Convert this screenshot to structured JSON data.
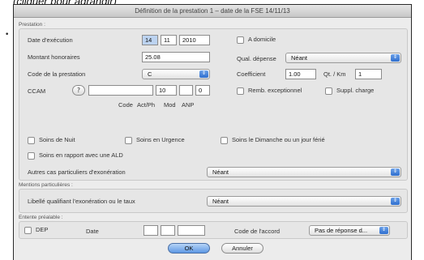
{
  "caption": "(cliquer pour agrandir)",
  "bullet": "•",
  "dialog": {
    "title": "Définition de la prestation 1 – date de la FSE 14/11/13"
  },
  "prestation": {
    "section_label": "Prestation :",
    "date_label": "Date d'exécution",
    "date_day": "14",
    "date_month": "11",
    "date_year": "2010",
    "domicile_label": "A domicile",
    "montant_label": "Montant honoraires",
    "montant_value": "25.08",
    "qual_label": "Qual. dépense",
    "qual_value": "Néant",
    "code_label": "Code de la prestation",
    "code_value": "C",
    "coeff_label": "Coefficient",
    "coeff_value": "1.00",
    "qt_label": "Qt. / Km",
    "qt_value": "1",
    "ccam_label": "CCAM",
    "ccam_help": "?",
    "ccam_act": "10",
    "ccam_mod": "0",
    "remb_label": "Remb. exceptionnel",
    "suppl_label": "Suppl. charge",
    "col_code": "Code",
    "col_actph": "Act/Ph",
    "col_mod": "Mod",
    "col_anp": "ANP",
    "nuit_label": "Soins de Nuit",
    "urgence_label": "Soins en Urgence",
    "dimanche_label": "Soins le Dimanche ou un jour férié",
    "ald_label": "Soins en rapport avec une ALD",
    "autres_label": "Autres cas particuliers d'exonération",
    "autres_value": "Néant"
  },
  "mentions": {
    "section_label": "Mentions particulières :",
    "libelle_label": "Libellé qualifiant l'exonération ou le taux",
    "libelle_value": "Néant"
  },
  "entente": {
    "section_label": "Entente préalable :",
    "dep_label": "DEP",
    "date_label": "Date",
    "code_label": "Code de l'accord",
    "code_value": "Pas de réponse d..."
  },
  "buttons": {
    "ok": "OK",
    "cancel": "Annuler"
  }
}
